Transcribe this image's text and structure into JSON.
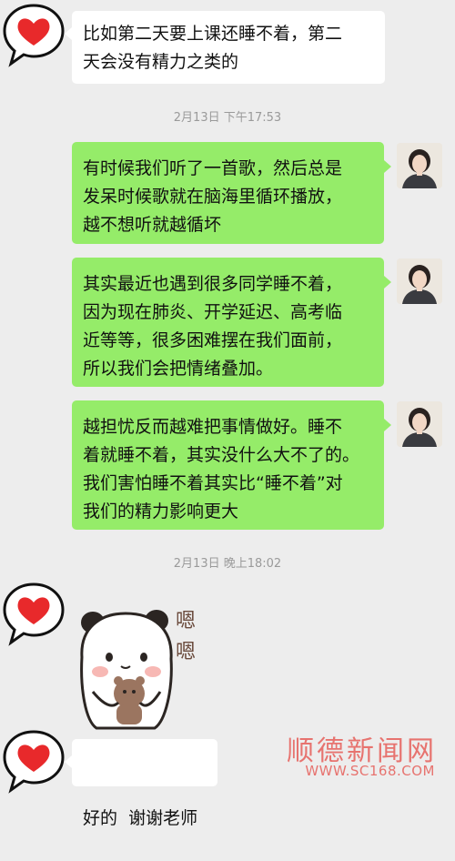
{
  "messages": {
    "m1": {
      "line1": "比如第二天要上课还睡不着，第二",
      "line2": "天会没有精力之类的"
    },
    "ts1": "2月13日 下午17:53",
    "m2": {
      "line1": "有时候我们听了一首歌，然后总是",
      "line2": "发呆时候歌就在脑海里循环播放，",
      "line3": "越不想听就越循坏"
    },
    "m3": {
      "line1": "其实最近也遇到很多同学睡不着，",
      "line2": "因为现在肺炎、开学延迟、高考临",
      "line3": "近等等，很多困难摆在我们面前，",
      "line4": "所以我们会把情绪叠加。"
    },
    "m4": {
      "line1": "越担忧反而越难把事情做好。睡不",
      "line2": "着就睡不着，其实没什么大不了的。",
      "line3": "我们害怕睡不着其实比“睡不着”对",
      "line4": "我们的精力影响更大"
    },
    "ts2": "2月13日 晚上18:02",
    "sticker_text": {
      "line1": "嗯",
      "line2": "嗯"
    },
    "m5": "好的  谢谢老师"
  },
  "watermark": {
    "title": "顺德新闻网",
    "url": "WWW.SC168.COM"
  },
  "colors": {
    "background": "#ededed",
    "outgoing_bubble": "#95ec69",
    "incoming_bubble": "#ffffff",
    "heart": "#e8292b",
    "watermark": "#e7736f"
  }
}
